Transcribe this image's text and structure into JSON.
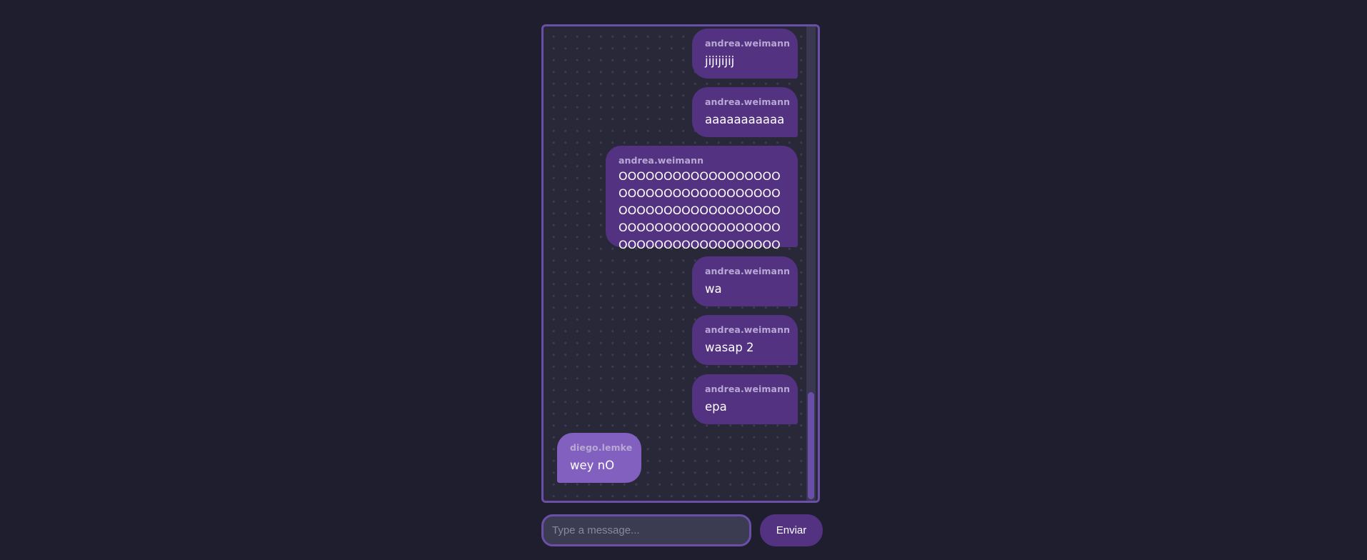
{
  "chat": {
    "messages": [
      {
        "author": "andrea.weimann",
        "text": "jijijijij",
        "self": true
      },
      {
        "author": "andrea.weimann",
        "text": "aaaaaaaaaaa",
        "self": true
      },
      {
        "author": "andrea.weimann",
        "text": "OOOOOOOOOOOOOOOOOOOOOOOOOOOOOOOOOOOOOOOOOOOOOOOOOOOOOOOOOOOOOOOOOOOOOOOOOOOOOOOOOOOOOOOOOO",
        "self": true
      },
      {
        "author": "andrea.weimann",
        "text": "wa",
        "self": true
      },
      {
        "author": "andrea.weimann",
        "text": "wasap 2",
        "self": true
      },
      {
        "author": "andrea.weimann",
        "text": "epa",
        "self": true
      },
      {
        "author": "diego.lemke",
        "text": "wey nO",
        "self": false
      }
    ]
  },
  "composer": {
    "placeholder": "Type a message...",
    "value": "",
    "send_label": "Enviar"
  },
  "colors": {
    "background": "#1f1e2e",
    "self_bubble": "#543282",
    "other_bubble": "#8160bf",
    "accent": "#6a4fa8"
  }
}
